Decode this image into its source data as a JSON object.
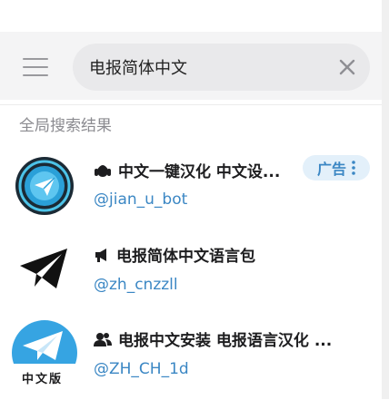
{
  "search": {
    "query": "电报简体中文"
  },
  "section": {
    "title": "全局搜索结果"
  },
  "results": [
    {
      "title": "中文一键汉化 中文设...",
      "username": "@jian_u_bot",
      "type_icon": "bot-icon",
      "badge": "广告",
      "badge_icon": "more-vert-icon"
    },
    {
      "title": "电报简体中文语言包",
      "username": "@zh_cnzzll",
      "type_icon": "megaphone-icon"
    },
    {
      "title": "电报中文安装 电报语言汉化 ...",
      "username": "@ZH_CH_1d",
      "type_icon": "group-icon",
      "avatar_text": "中文版"
    }
  ],
  "colors": {
    "link": "#3b87c4",
    "badge_bg": "#e3f0fa",
    "telegram_blue": "#36a4e2"
  }
}
